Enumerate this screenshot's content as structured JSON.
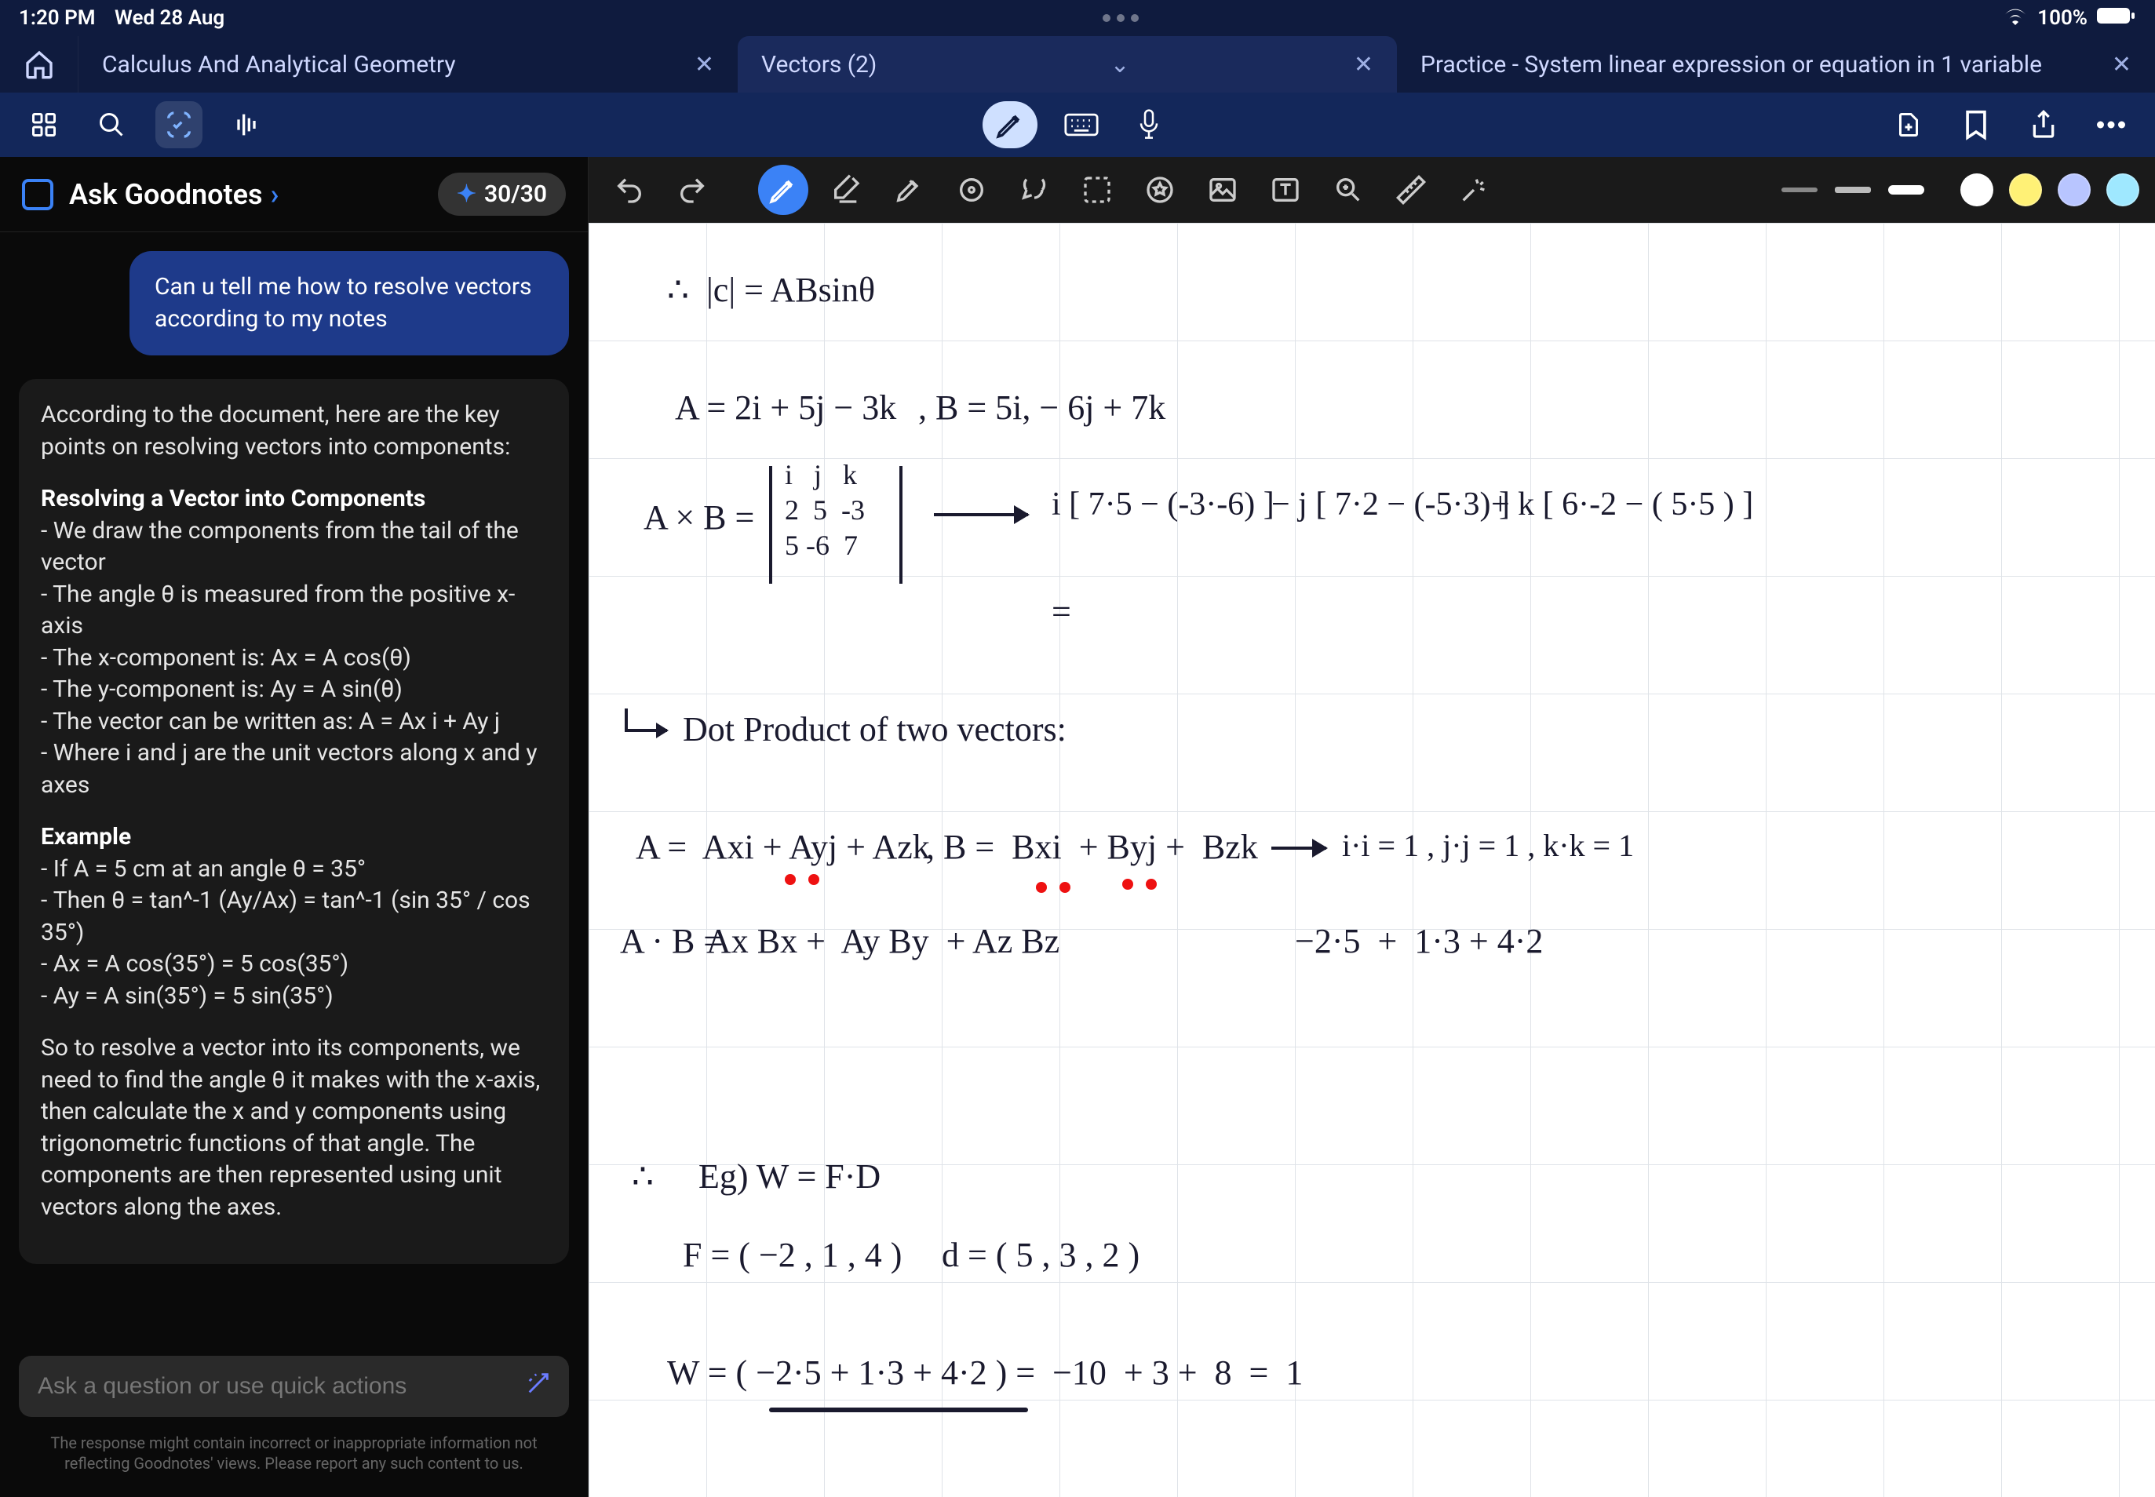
{
  "status": {
    "time": "1:20 PM",
    "date": "Wed 28 Aug",
    "battery_pct": "100%"
  },
  "tabs": {
    "t0": {
      "label": "Calculus And Analytical Geometry"
    },
    "t1": {
      "label": "Vectors (2)"
    },
    "t2": {
      "label": "Practice - System linear expression or equation in 1 variable"
    }
  },
  "sidebar": {
    "title": "Ask Goodnotes",
    "credits": "30/30",
    "user_msg": "Can u tell me how to resolve vectors according to my notes",
    "asst_intro": "According to the document, here are the key points on resolving vectors into components:",
    "asst_h1": "Resolving a Vector into Components",
    "asst_b1": "- We draw the components from the tail of the vector",
    "asst_b2": "- The angle θ is measured from the positive x-axis",
    "asst_b3": "- The x-component is: Ax = A cos(θ)",
    "asst_b4": "- The y-component is: Ay = A sin(θ)",
    "asst_b5": "- The vector can be written as: A = Ax i + Ay j",
    "asst_b6": "- Where i and j are the unit vectors along x and y axes",
    "asst_h2": "Example",
    "asst_e1": "- If A = 5 cm at an angle θ = 35°",
    "asst_e2": "- Then θ = tan^-1 (Ay/Ax) = tan^-1 (sin 35° / cos 35°)",
    "asst_e3": "- Ax = A cos(35°) = 5 cos(35°)",
    "asst_e4": "- Ay = A sin(35°) = 5 sin(35°)",
    "asst_outro": "So to resolve a vector into its components, we need to find the angle θ it makes with the x-axis, then calculate the x and y components using trigonometric functions of that angle. The components are then represented using unit vectors along the axes.",
    "input_placeholder": "Ask a question or use quick actions",
    "disclaimer": "The response might contain incorrect or inappropriate information not reflecting Goodnotes' views. Please report any such content to us."
  },
  "tools": {
    "stroke_colors": {
      "c1": "#ffffff",
      "c2": "#fff176",
      "c3": "#b8c5ff",
      "c4": "#9fe8ff"
    }
  },
  "notes": {
    "l1": "∴  |c| = ABsinθ",
    "l2a": "A = 2i + 5j − 3k",
    "l2b": ", B = 5i, − 6j + 7k",
    "l3_label": "A × B =",
    "l3_m_r1": "i   j   k",
    "l3_m_r2": "2  5  -3",
    "l3_m_r3": "5 -6  7",
    "l3_exp_i": "i [ 7·5 − (-3·-6) ]",
    "l3_exp_j": "− j [ 7·2 − (-5·3) ]",
    "l3_exp_k": "+ k [ 6·-2 − ( 5·5 ) ]",
    "l4_eq": "=",
    "l5": "Dot Product of two vectors:",
    "l6a": "A =  Axi + Ayj + Azk",
    "l6b": ", B =  Bxi  + Byj +  Bzk",
    "l6c": "i·i = 1 , j·j = 1 , k·k = 1",
    "l7a": "A · B =",
    "l7b": "Ax Bx +  Ay By  + Az Bz",
    "l7c": "−2·5  +  1·3 + 4·2",
    "l8": "∴",
    "l9": "Eg) W = F·D",
    "l10a": "F = ( −2 , 1 , 4 )",
    "l10b": "d = ( 5 , 3 , 2 )",
    "l11": "W = ( −2·5 + 1·3 + 4·2 ) =  −10  + 3 +  8  =  1"
  }
}
